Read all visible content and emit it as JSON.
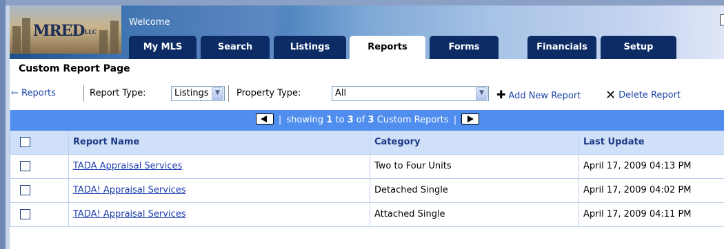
{
  "header": {
    "logo_text": "MRED",
    "logo_suffix": "LLC",
    "welcome": "Welcome"
  },
  "tabs": [
    {
      "label": "My MLS",
      "active": false
    },
    {
      "label": "Search",
      "active": false
    },
    {
      "label": "Listings",
      "active": false
    },
    {
      "label": "Reports",
      "active": true
    },
    {
      "label": "Forms",
      "active": false
    },
    {
      "label": "Financials",
      "active": false
    },
    {
      "label": "Setup",
      "active": false
    }
  ],
  "page": {
    "title": "Custom Report Page"
  },
  "toolbar": {
    "back_label": "Reports",
    "report_type_label": "Report Type:",
    "report_type_value": "Listings",
    "property_type_label": "Property Type:",
    "property_type_value": "All",
    "add_label": "Add New Report",
    "delete_label": "Delete Report"
  },
  "pager": {
    "prefix": "showing",
    "from": "1",
    "to_word": "to",
    "to": "3",
    "of_word": "of",
    "total": "3",
    "suffix": "Custom Reports"
  },
  "table": {
    "headers": [
      "Report Name",
      "Category",
      "Last Update"
    ],
    "rows": [
      {
        "name": "TADA Appraisal Services",
        "category": "Two to Four Units",
        "updated": "April 17, 2009 04:13 PM"
      },
      {
        "name": "TADA! Appraisal Services",
        "category": "Detached Single",
        "updated": "April 17, 2009 04:02 PM"
      },
      {
        "name": "TADA! Appraisal Services",
        "category": "Attached Single",
        "updated": "April 17, 2009 04:11 PM"
      }
    ]
  },
  "colors": {
    "tab_bg": "#0d2c66",
    "pager_bg": "#4f8dee",
    "header_row_bg": "#cfe0f8",
    "link": "#1f3fb0"
  },
  "icons": {
    "back": "arrow-left-icon",
    "add": "plus-icon",
    "delete": "x-icon",
    "prev": "prev-page-icon",
    "next": "next-page-icon"
  }
}
